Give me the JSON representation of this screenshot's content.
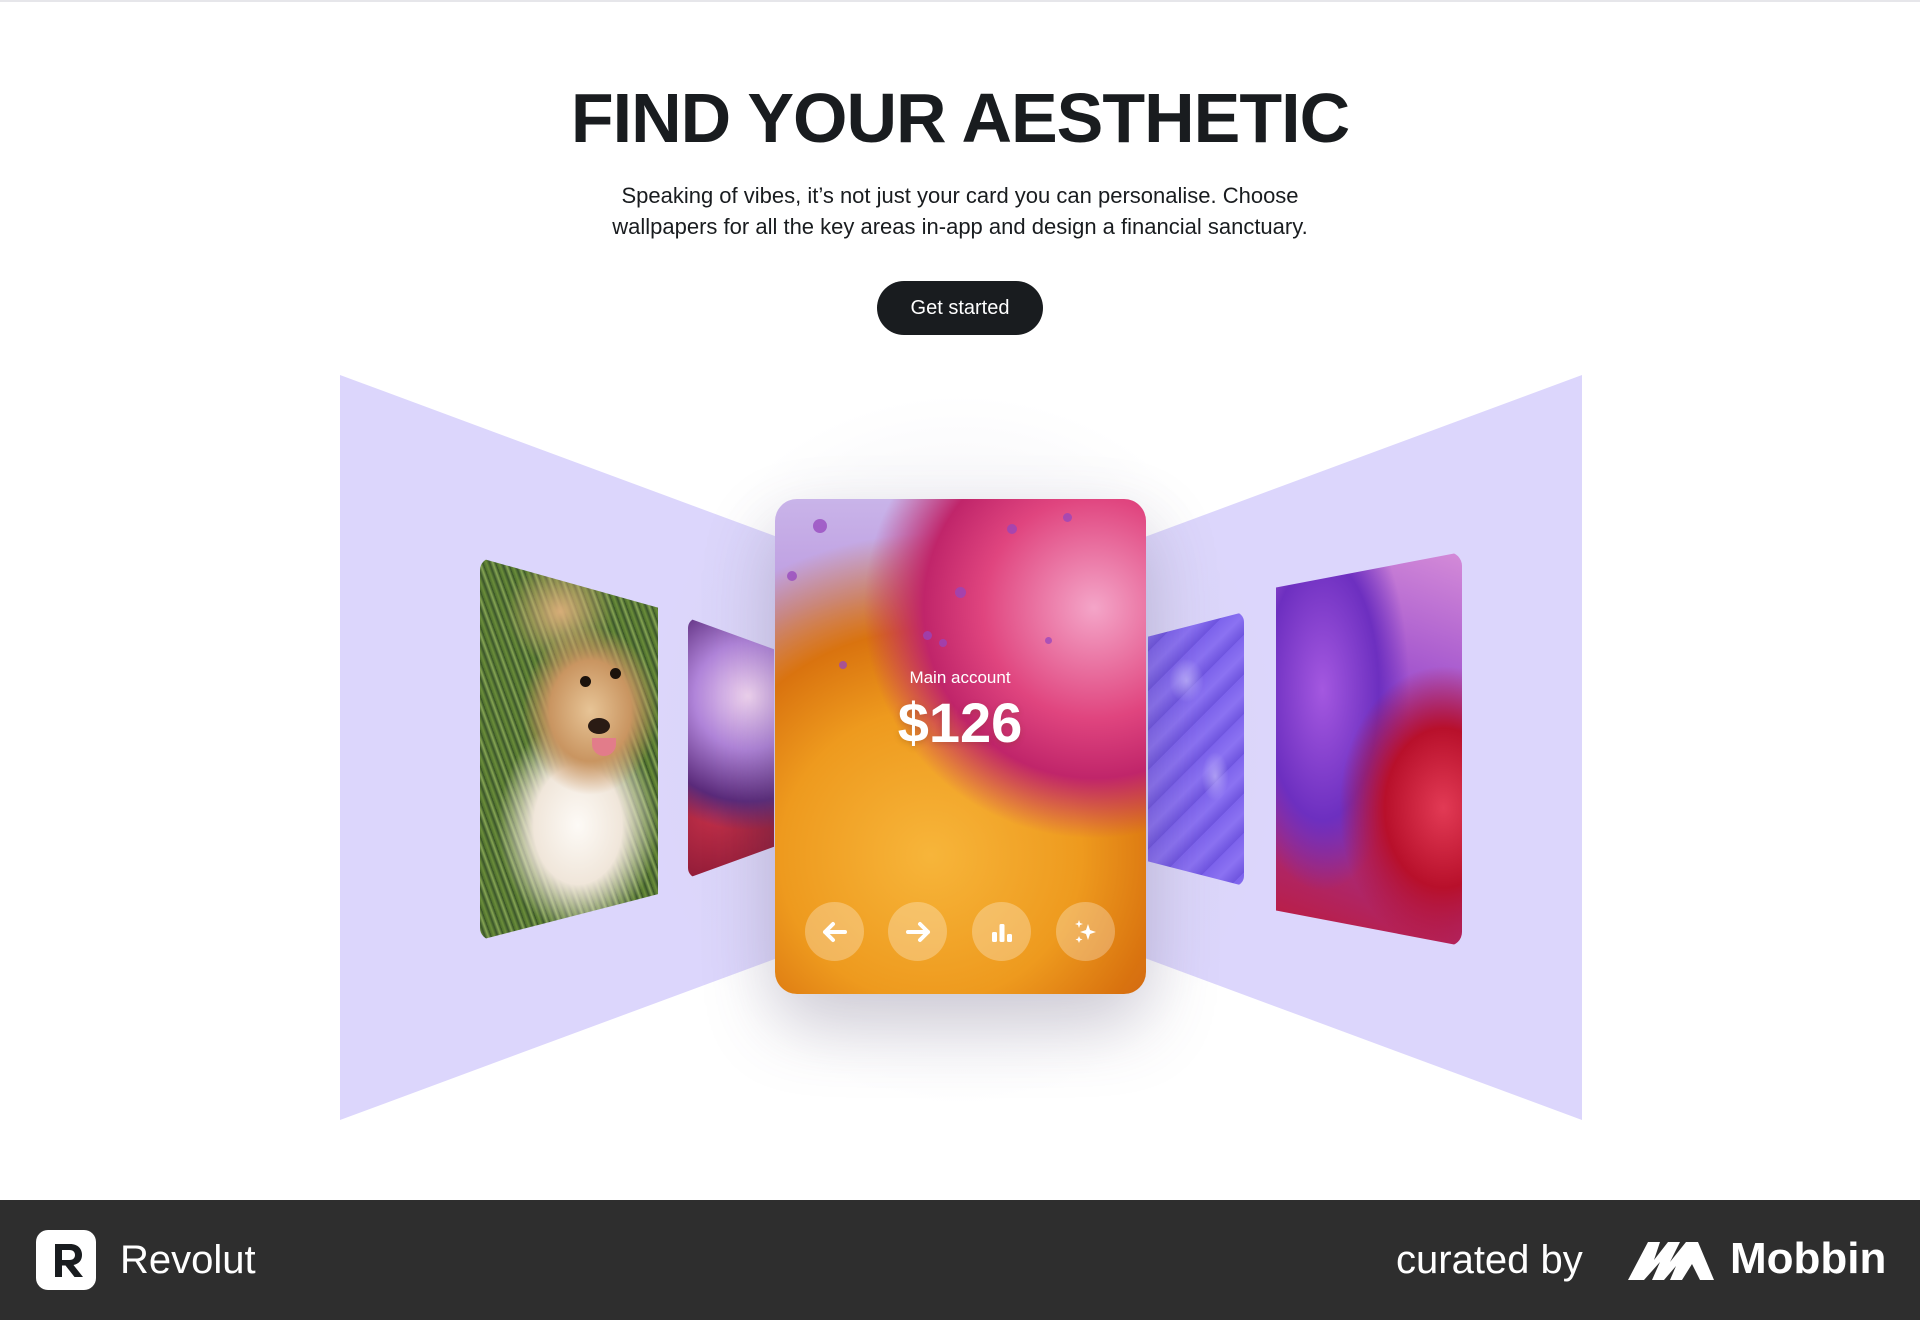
{
  "hero": {
    "title": "FIND YOUR AESTHETIC",
    "subtitle_line1": "Speaking of vibes, it’s not just your card you can personalise. Choose",
    "subtitle_line2": "wallpapers for all the key areas in-app and design a financial sanctuary.",
    "cta_label": "Get started"
  },
  "card": {
    "account_label": "Main account",
    "balance": "$126",
    "actions": [
      {
        "icon": "arrow-left-icon"
      },
      {
        "icon": "arrow-right-icon"
      },
      {
        "icon": "bar-chart-icon"
      },
      {
        "icon": "sparkles-icon"
      }
    ]
  },
  "wallpapers": [
    "dog-photo",
    "purple-orb",
    "center-gradient",
    "pattern",
    "purple-silk"
  ],
  "colors": {
    "backdrop": "#dcd6fc",
    "cta_bg": "#191c1f",
    "footer_bg": "#2e2e2e",
    "text": "#191c1f"
  },
  "footer": {
    "app_name": "Revolut",
    "curated_label": "curated by",
    "curator_name": "Mobbin"
  }
}
